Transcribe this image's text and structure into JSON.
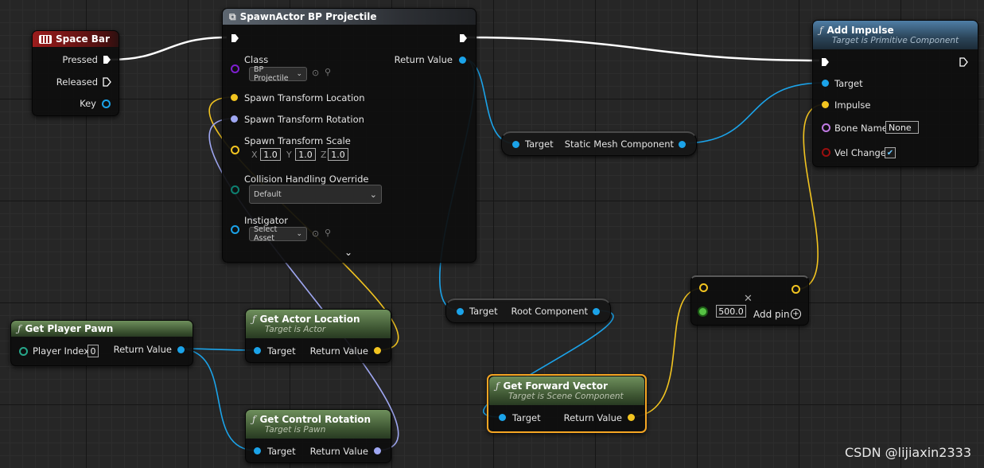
{
  "colors": {
    "exec": "#ffffff",
    "object": "#1ba3e9",
    "vector": "#f2c420",
    "rotator": "#9fa7f2",
    "transform": "#f08a24",
    "class": "#7e1fd0",
    "enum": "#0d7f70",
    "name": "#c07ae3",
    "bool": "#9a0f0f",
    "struct": "#27a68a",
    "float": "#56c244",
    "selection": "#f5a623"
  },
  "space_bar": {
    "title": "Space Bar",
    "icon": "keyboard-icon",
    "pressed": "Pressed",
    "released": "Released",
    "key": "Key"
  },
  "spawn": {
    "title": "SpawnActor BP Projectile",
    "icon": "spawn-actor-icon",
    "class_label": "Class",
    "class_value": "BP Projectile",
    "return_value": "Return Value",
    "loc_label": "Spawn Transform Location",
    "rot_label": "Spawn Transform Rotation",
    "scale_label": "Spawn Transform Scale",
    "scale_x_axis": "X",
    "scale_y_axis": "Y",
    "scale_z_axis": "Z",
    "scale_x": "1.0",
    "scale_y": "1.0",
    "scale_z": "1.0",
    "collision_label": "Collision Handling Override",
    "collision_value": "Default",
    "instigator_label": "Instigator",
    "instigator_value": "Select Asset"
  },
  "add_impulse": {
    "title": "Add Impulse",
    "subtitle": "Target is Primitive Component",
    "target": "Target",
    "impulse": "Impulse",
    "bone_name": "Bone Name",
    "bone_name_value": "None",
    "vel_change": "Vel Change",
    "vel_change_checked": true
  },
  "static_mesh": {
    "target": "Target",
    "output": "Static Mesh Component"
  },
  "root_comp": {
    "target": "Target",
    "output": "Root Component"
  },
  "multiply": {
    "input_value": "500.0",
    "add_pin": "Add pin"
  },
  "get_player_pawn": {
    "title": "Get Player Pawn",
    "player_index": "Player Index",
    "player_index_value": "0",
    "return_value": "Return Value"
  },
  "get_actor_location": {
    "title": "Get Actor Location",
    "subtitle": "Target is Actor",
    "target": "Target",
    "return_value": "Return Value"
  },
  "get_forward_vector": {
    "title": "Get Forward Vector",
    "subtitle": "Target is Scene Component",
    "target": "Target",
    "return_value": "Return Value"
  },
  "get_control_rotation": {
    "title": "Get Control Rotation",
    "subtitle": "Target is Pawn",
    "target": "Target",
    "return_value": "Return Value"
  },
  "watermark": "CSDN @lijiaxin2333"
}
